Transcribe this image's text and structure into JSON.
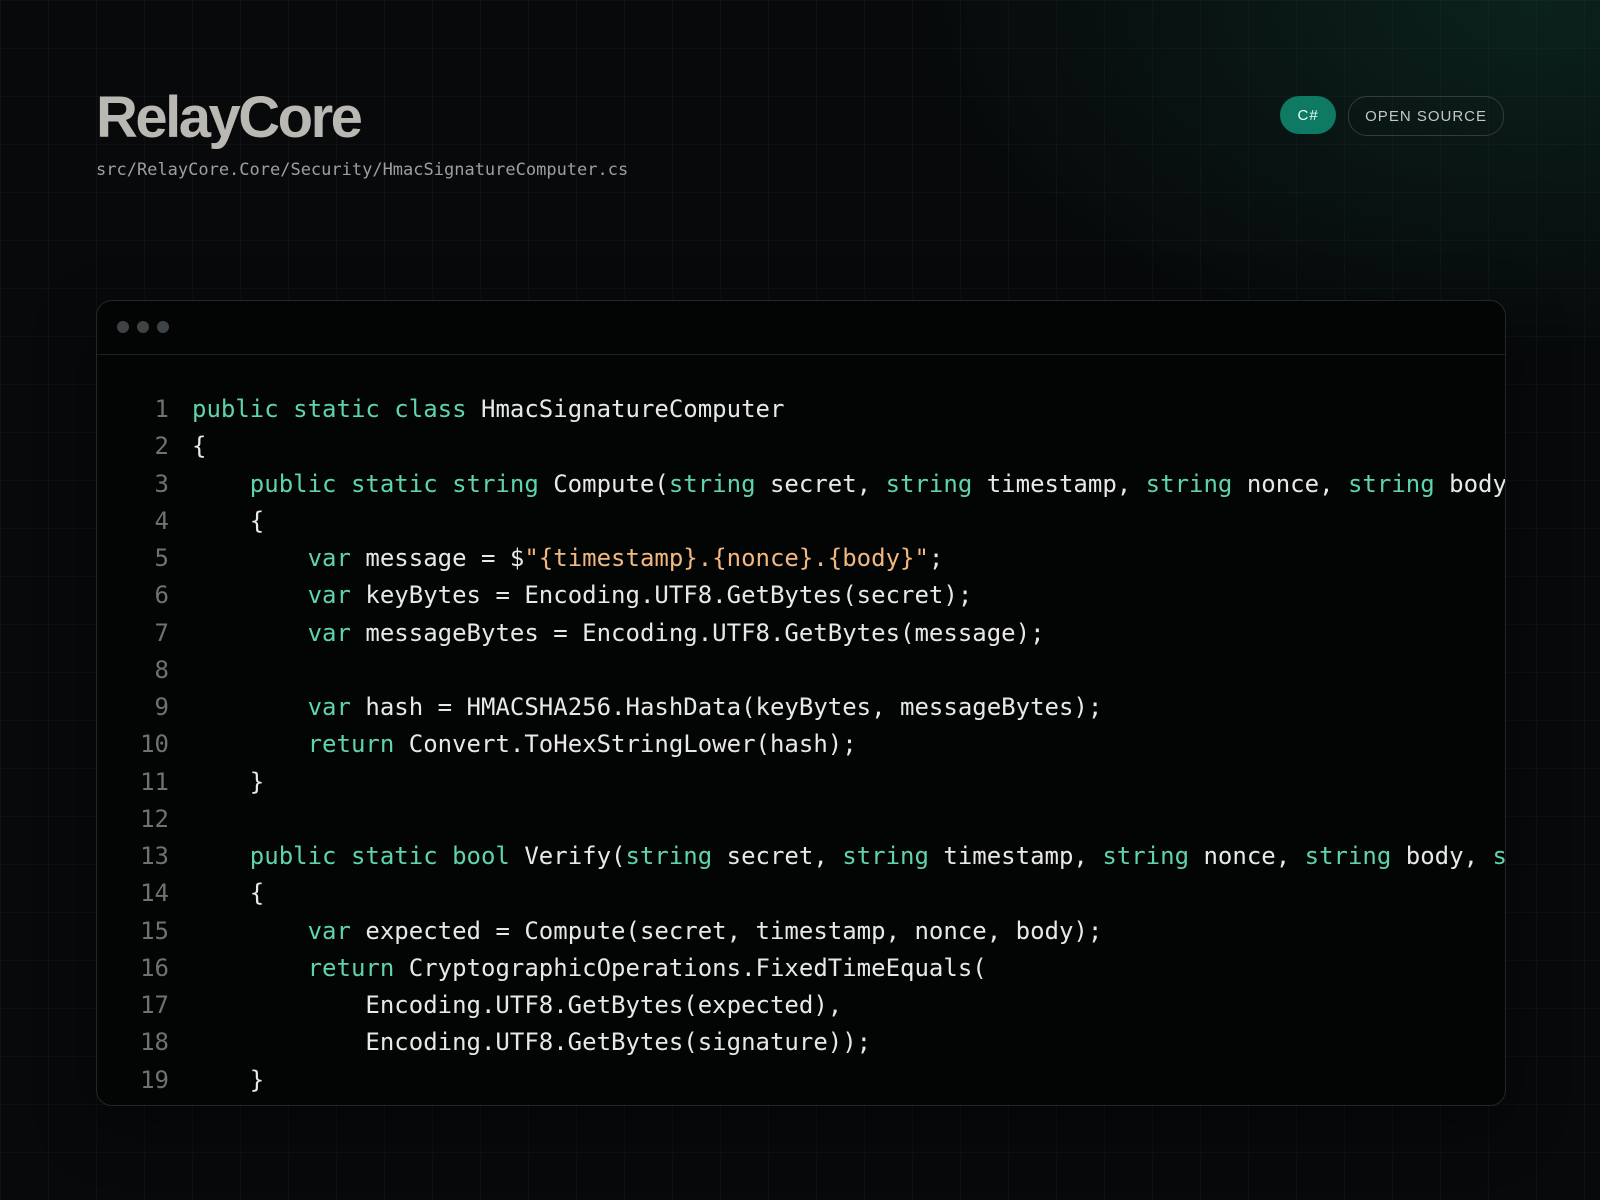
{
  "header": {
    "brand": "RelayCore",
    "file_path": "src/RelayCore.Core/Security/HmacSignatureComputer.cs",
    "language_badge": "C#",
    "license_badge": "OPEN SOURCE"
  },
  "colors": {
    "accent": "#0e7a63",
    "keyword": "#5fd3ad",
    "string": "#f2b880",
    "text": "#e8e8e8",
    "line_number": "#6d7371"
  },
  "code_lines": [
    {
      "n": "1",
      "tokens": [
        {
          "t": "kw",
          "v": "public static class"
        },
        {
          "t": "p",
          "v": " HmacSignatureComputer"
        }
      ]
    },
    {
      "n": "2",
      "tokens": [
        {
          "t": "p",
          "v": "{"
        }
      ]
    },
    {
      "n": "3",
      "tokens": [
        {
          "t": "p",
          "v": "    "
        },
        {
          "t": "kw",
          "v": "public static string"
        },
        {
          "t": "p",
          "v": " Compute("
        },
        {
          "t": "kw",
          "v": "string"
        },
        {
          "t": "p",
          "v": " secret, "
        },
        {
          "t": "kw",
          "v": "string"
        },
        {
          "t": "p",
          "v": " timestamp, "
        },
        {
          "t": "kw",
          "v": "string"
        },
        {
          "t": "p",
          "v": " nonce, "
        },
        {
          "t": "kw",
          "v": "string"
        },
        {
          "t": "p",
          "v": " body"
        }
      ]
    },
    {
      "n": "4",
      "tokens": [
        {
          "t": "p",
          "v": "    {"
        }
      ]
    },
    {
      "n": "5",
      "tokens": [
        {
          "t": "p",
          "v": "        "
        },
        {
          "t": "kw",
          "v": "var"
        },
        {
          "t": "p",
          "v": " message = $"
        },
        {
          "t": "str",
          "v": "\"{timestamp}.{nonce}.{body}\""
        },
        {
          "t": "p",
          "v": ";"
        }
      ]
    },
    {
      "n": "6",
      "tokens": [
        {
          "t": "p",
          "v": "        "
        },
        {
          "t": "kw",
          "v": "var"
        },
        {
          "t": "p",
          "v": " keyBytes = Encoding.UTF8.GetBytes(secret);"
        }
      ]
    },
    {
      "n": "7",
      "tokens": [
        {
          "t": "p",
          "v": "        "
        },
        {
          "t": "kw",
          "v": "var"
        },
        {
          "t": "p",
          "v": " messageBytes = Encoding.UTF8.GetBytes(message);"
        }
      ]
    },
    {
      "n": "8",
      "tokens": []
    },
    {
      "n": "9",
      "tokens": [
        {
          "t": "p",
          "v": "        "
        },
        {
          "t": "kw",
          "v": "var"
        },
        {
          "t": "p",
          "v": " hash = HMACSHA256.HashData(keyBytes, messageBytes);"
        }
      ]
    },
    {
      "n": "10",
      "tokens": [
        {
          "t": "p",
          "v": "        "
        },
        {
          "t": "kw",
          "v": "return"
        },
        {
          "t": "p",
          "v": " Convert.ToHexStringLower(hash);"
        }
      ]
    },
    {
      "n": "11",
      "tokens": [
        {
          "t": "p",
          "v": "    }"
        }
      ]
    },
    {
      "n": "12",
      "tokens": []
    },
    {
      "n": "13",
      "tokens": [
        {
          "t": "p",
          "v": "    "
        },
        {
          "t": "kw",
          "v": "public static bool"
        },
        {
          "t": "p",
          "v": " Verify("
        },
        {
          "t": "kw",
          "v": "string"
        },
        {
          "t": "p",
          "v": " secret, "
        },
        {
          "t": "kw",
          "v": "string"
        },
        {
          "t": "p",
          "v": " timestamp, "
        },
        {
          "t": "kw",
          "v": "string"
        },
        {
          "t": "p",
          "v": " nonce, "
        },
        {
          "t": "kw",
          "v": "string"
        },
        {
          "t": "p",
          "v": " body, "
        },
        {
          "t": "kw",
          "v": "s"
        }
      ]
    },
    {
      "n": "14",
      "tokens": [
        {
          "t": "p",
          "v": "    {"
        }
      ]
    },
    {
      "n": "15",
      "tokens": [
        {
          "t": "p",
          "v": "        "
        },
        {
          "t": "kw",
          "v": "var"
        },
        {
          "t": "p",
          "v": " expected = Compute(secret, timestamp, nonce, body);"
        }
      ]
    },
    {
      "n": "16",
      "tokens": [
        {
          "t": "p",
          "v": "        "
        },
        {
          "t": "kw",
          "v": "return"
        },
        {
          "t": "p",
          "v": " CryptographicOperations.FixedTimeEquals("
        }
      ]
    },
    {
      "n": "17",
      "tokens": [
        {
          "t": "p",
          "v": "            Encoding.UTF8.GetBytes(expected),"
        }
      ]
    },
    {
      "n": "18",
      "tokens": [
        {
          "t": "p",
          "v": "            Encoding.UTF8.GetBytes(signature));"
        }
      ]
    },
    {
      "n": "19",
      "tokens": [
        {
          "t": "p",
          "v": "    }"
        }
      ]
    }
  ]
}
